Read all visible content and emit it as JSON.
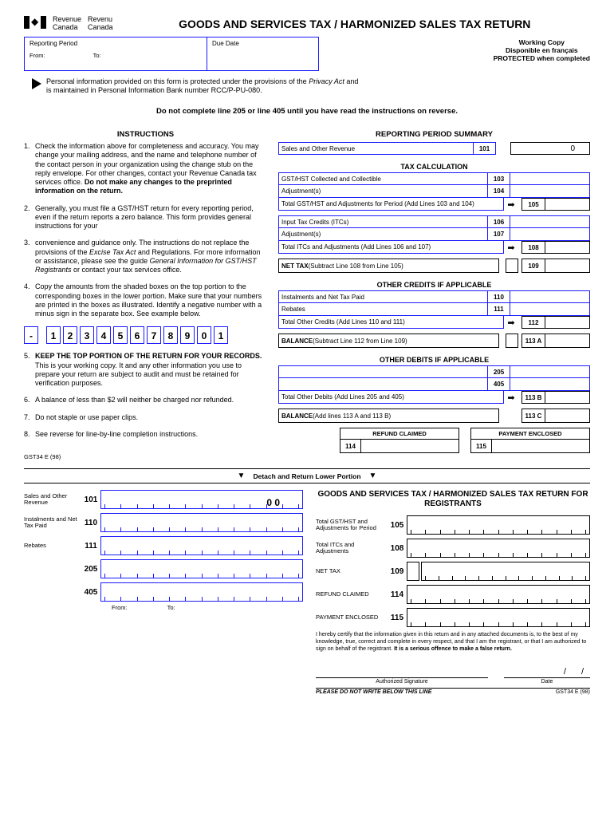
{
  "agency": {
    "en_line1": "Revenue",
    "en_line2": "Canada",
    "fr_line1": "Revenu",
    "fr_line2": "Canada"
  },
  "title": "GOODS AND SERVICES TAX / HARMONIZED SALES TAX  RETURN",
  "topBoxes": {
    "period_label": "Reporting Period",
    "from": "From:",
    "to": "To:",
    "due": "Due Date"
  },
  "topRight": {
    "l1": "Working Copy",
    "l2": "Disponible en français",
    "l3": "PROTECTED when completed"
  },
  "privacy": {
    "l1_a": "Personal information provided on this form is protected under the provisions of the ",
    "l1_b": "Privacy Act",
    "l1_c": " and",
    "l2": "is maintained in Personal Information Bank number RCC/P-PU-080."
  },
  "warning": "Do not complete line 205 or line 405 until you have read the instructions on reverse.",
  "instructions_head": "INSTRUCTIONS",
  "instructions": [
    {
      "n": "1.",
      "text_a": "Check the information above for completeness and accuracy. You may change your mailing  address, and the name and telephone number of the contact person in your organization using the change stub on the reply envelope. For other changes, contact your Revenue Canada tax services office. ",
      "text_b": "Do not make any changes to the preprinted information on the return."
    },
    {
      "n": "2.",
      "text_a": "Generally, you must file a GST/HST return for every reporting period, even if the return reports a zero balance. This form provides general instructions for your"
    },
    {
      "n": "3.",
      "text_a": "convenience and guidance only. The instructions do not replace the provisions of the ",
      "text_i": "Excise Tax Act",
      "text_b": " and Regulations. For more information or assistance, please see the guide ",
      "text_i2": "General Information for GST/HST Registrants",
      "text_c": " or contact your tax services office."
    },
    {
      "n": "4.",
      "text_a": "Copy the amounts from the shaded boxes on the top portion to the corresponding boxes in the lower portion. Make sure that your numbers are printed in the boxes as illustrated. Identify a negative number with a minus sign in the separate box.  See example below."
    },
    {
      "n": "5.",
      "text_b": "KEEP THE TOP PORTION OF THE RETURN FOR YOUR RECORDS.",
      "text_a": " This is your working copy. It and any other information you use to prepare your return are subject to audit and must be retained for verification purposes."
    },
    {
      "n": "6.",
      "text_a": "A balance of less than $2 will neither be charged nor refunded."
    },
    {
      "n": "7.",
      "text_a": "Do not staple or use paper clips."
    },
    {
      "n": "8.",
      "text_a": "See reverse for line-by-line completion instructions."
    }
  ],
  "digits": [
    "-",
    "1",
    "2",
    "3",
    "4",
    "5",
    "6",
    "7",
    "8",
    "9",
    "0",
    "1"
  ],
  "summary_head": "REPORTING PERIOD SUMMARY",
  "lines": {
    "r101": {
      "label": "Sales and Other Revenue",
      "num": "101",
      "val": "0"
    },
    "taxcalc_head": "TAX CALCULATION",
    "r103": {
      "label": "GST/HST Collected and Collectible",
      "num": "103"
    },
    "r104": {
      "label": "Adjustment(s)",
      "num": "104"
    },
    "r105t": {
      "label": "Total GST/HST and Adjustments for Period (Add Lines 103 and 104)",
      "num": "105"
    },
    "r106": {
      "label": "Input Tax Credits (ITCs)",
      "num": "106"
    },
    "r107": {
      "label": "Adjustment(s)",
      "num": "107"
    },
    "r108t": {
      "label": "Total ITCs and Adjustments (Add Lines 106 and 107)",
      "num": "108"
    },
    "net": {
      "label_a": "NET TAX",
      "label_b": " (Subtract Line 108 from Line 105)",
      "num": "109"
    },
    "credits_head": "OTHER CREDITS IF APPLICABLE",
    "r110": {
      "label": "Instalments and Net Tax Paid",
      "num": "110"
    },
    "r111": {
      "label": "Rebates",
      "num": "111"
    },
    "r112t": {
      "label": "Total Other Credits (Add Lines 110 and 111)",
      "num": "112"
    },
    "bal1": {
      "label_a": "BALANCE",
      "label_b": " (Subtract Line 112 from Line 109)",
      "num": "113 A"
    },
    "debits_head": "OTHER DEBITS IF APPLICABLE",
    "r205": {
      "label": "",
      "num": "205"
    },
    "r405": {
      "label": "",
      "num": "405"
    },
    "r113bt": {
      "label": "Total Other Debits (Add Lines 205 and 405)",
      "num": "113 B"
    },
    "bal2": {
      "label_a": "BALANCE",
      "label_b": " (Add lines 113 A and 113 B)",
      "num": "113 C"
    },
    "refund": {
      "head": "REFUND CLAIMED",
      "num": "114"
    },
    "payment": {
      "head": "PAYMENT ENCLOSED",
      "num": "115"
    }
  },
  "detach": "Detach and Return Lower Portion",
  "form_code": "GST34 E (98)",
  "lower": {
    "title": "GOODS AND SERVICES TAX / HARMONIZED SALES TAX RETURN FOR REGISTRANTS",
    "left_rows": [
      {
        "label": "Sales and Other Revenue",
        "num": "101",
        "val": "0 0"
      },
      {
        "label": "Instalments and Net Tax Paid",
        "num": "110"
      },
      {
        "label": "Rebates",
        "num": "111"
      },
      {
        "label": "",
        "num": "205"
      },
      {
        "label": "",
        "num": "405"
      }
    ],
    "from": "From:",
    "to": "To:",
    "right_rows": [
      {
        "label": "Total GST/HST and Adjustments for Period",
        "num": "105"
      },
      {
        "label": "Total ITCs and Adjustments",
        "num": "108"
      },
      {
        "label": "NET  TAX",
        "num": "109",
        "sign": true
      },
      {
        "label": "REFUND  CLAIMED",
        "num": "114"
      },
      {
        "label": "PAYMENT ENCLOSED",
        "num": "115"
      }
    ],
    "cert": "I hereby certify that the information given in this return and in any attached documents is, to the best of my knowledge, true, correct and complete in every respect, and that I am the registrant, or that I am authorized to sign on behalf of the registrant. ",
    "cert_b": "It is a serious offence to make a false return.",
    "sig": "Authorized Signature",
    "date": "Date",
    "footer": "PLEASE DO NOT WRITE BELOW THIS LINE",
    "footer_code": "GST34 E (98)"
  }
}
